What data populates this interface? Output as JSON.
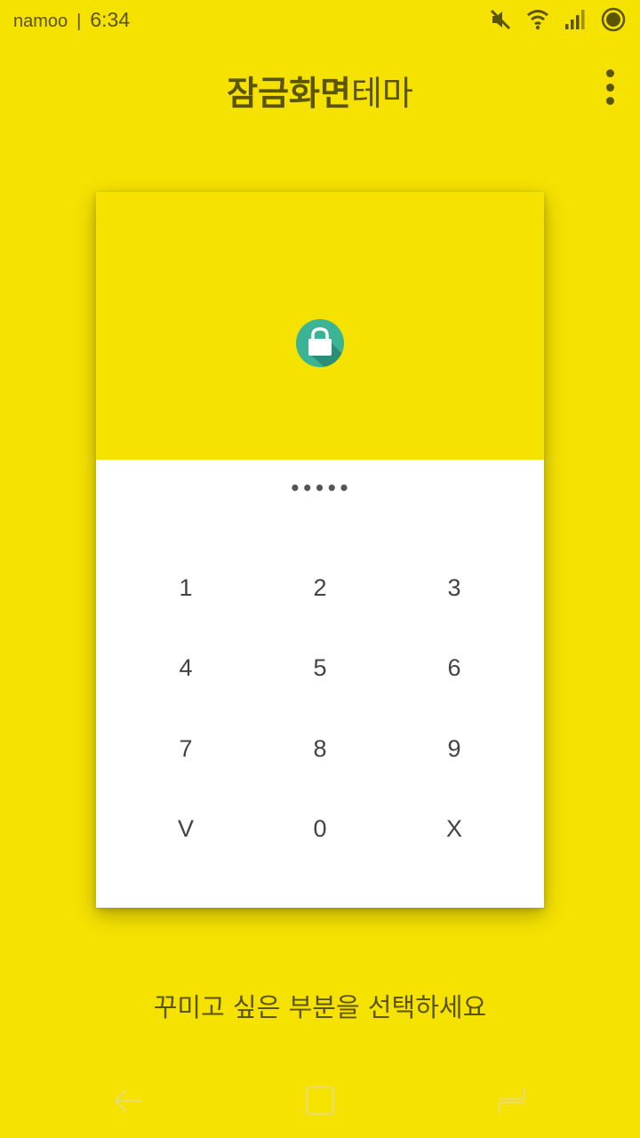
{
  "status": {
    "carrier": "namoo",
    "separator": "|",
    "time": "6:34",
    "icons": [
      "mute-icon",
      "wifi-icon",
      "signal-icon",
      "notification-icon"
    ]
  },
  "header": {
    "title_bold": "잠금화면",
    "title_regular": "테마",
    "menu_icon": "more-vert-icon"
  },
  "preview": {
    "lock_icon": "lock-icon",
    "pin_dots": "•••••",
    "keys": [
      {
        "label": "1",
        "name": "key-1"
      },
      {
        "label": "2",
        "name": "key-2"
      },
      {
        "label": "3",
        "name": "key-3"
      },
      {
        "label": "4",
        "name": "key-4"
      },
      {
        "label": "5",
        "name": "key-5"
      },
      {
        "label": "6",
        "name": "key-6"
      },
      {
        "label": "7",
        "name": "key-7"
      },
      {
        "label": "8",
        "name": "key-8"
      },
      {
        "label": "9",
        "name": "key-9"
      },
      {
        "label": "V",
        "name": "key-confirm"
      },
      {
        "label": "0",
        "name": "key-0"
      },
      {
        "label": "X",
        "name": "key-delete"
      }
    ]
  },
  "hint": "꾸미고 싶은 부분을 선택하세요",
  "navbar": {
    "items": [
      "back-icon",
      "home-icon",
      "recents-icon"
    ]
  },
  "colors": {
    "background": "#F5E200",
    "text": "#5b5400",
    "keypad_bg": "#ffffff",
    "lock_teal": "#3bb395"
  }
}
